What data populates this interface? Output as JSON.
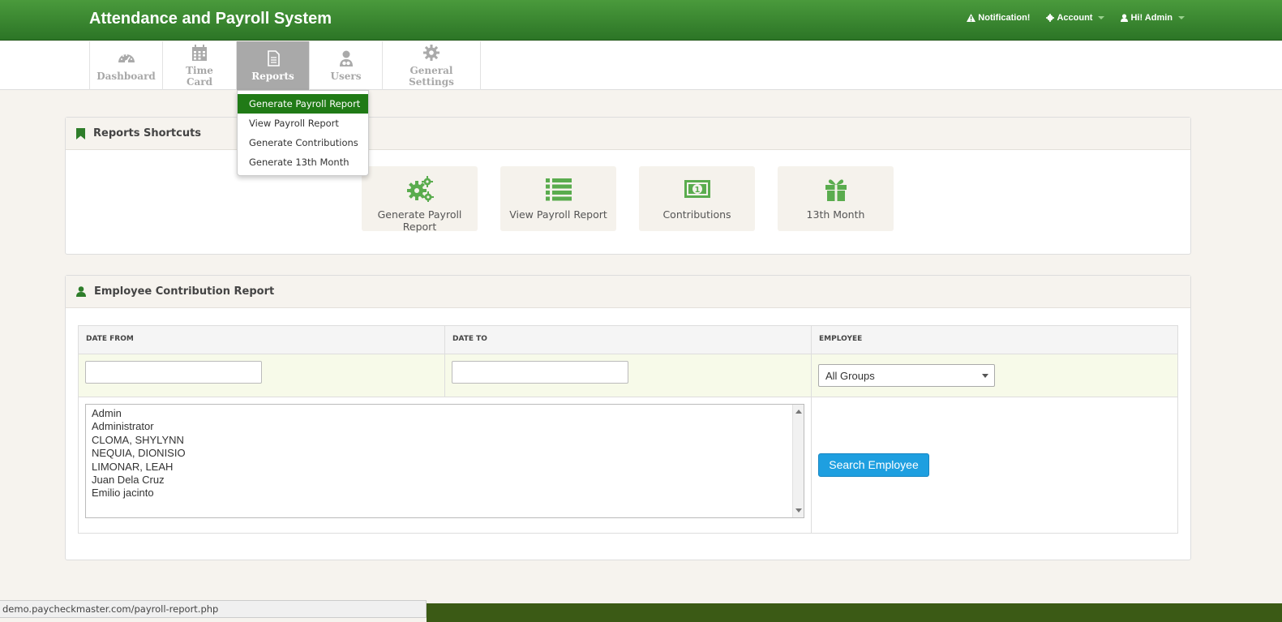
{
  "app": {
    "title": "Attendance and Payroll System",
    "accent": "#2c7526"
  },
  "topnav": {
    "notification": "Notification!",
    "account": "Account",
    "user": "Hi! Admin"
  },
  "menu": [
    {
      "label": "Dashboard",
      "icon": "dashboard-icon"
    },
    {
      "label": "Time Card",
      "icon": "calendar-icon"
    },
    {
      "label": "Reports",
      "icon": "document-icon",
      "active": true
    },
    {
      "label": "Users",
      "icon": "users-icon"
    },
    {
      "label": "General Settings",
      "icon": "gear-icon"
    }
  ],
  "dropdown": [
    "Generate Payroll Report",
    "View Payroll Report",
    "Generate Contributions",
    "Generate 13th Month"
  ],
  "shortcuts_panel": {
    "title": "Reports Shortcuts",
    "items": [
      {
        "label": "Generate Payroll Report",
        "icon": "gears-icon"
      },
      {
        "label": "View Payroll Report",
        "icon": "list-icon"
      },
      {
        "label": "Contributions",
        "icon": "money-icon"
      },
      {
        "label": "13th Month",
        "icon": "gift-icon"
      }
    ]
  },
  "contribution_panel": {
    "title": "Employee Contribution Report",
    "columns": [
      "DATE FROM",
      "DATE TO",
      "EMPLOYEE"
    ],
    "date_from": "",
    "date_to": "",
    "employee_group": "All Groups",
    "employees": [
      "Admin",
      "Administrator",
      "CLOMA, SHYLYNN",
      "NEQUIA, DIONISIO",
      "LIMONAR, LEAH",
      "Juan Dela Cruz",
      "Emilio jacinto"
    ],
    "search_button": "Search Employee"
  },
  "statusbar": {
    "url": "demo.paycheckmaster.com/payroll-report.php"
  }
}
